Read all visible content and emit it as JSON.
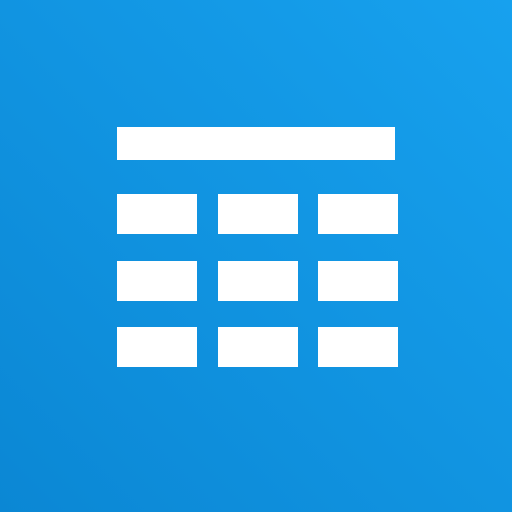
{
  "icon": {
    "name": "table-icon",
    "background_colors": [
      "#17a1ee",
      "#0b87d4"
    ],
    "glyph_color": "#ffffff",
    "header_row_count": 1,
    "grid_rows": 3,
    "grid_columns": 3
  }
}
